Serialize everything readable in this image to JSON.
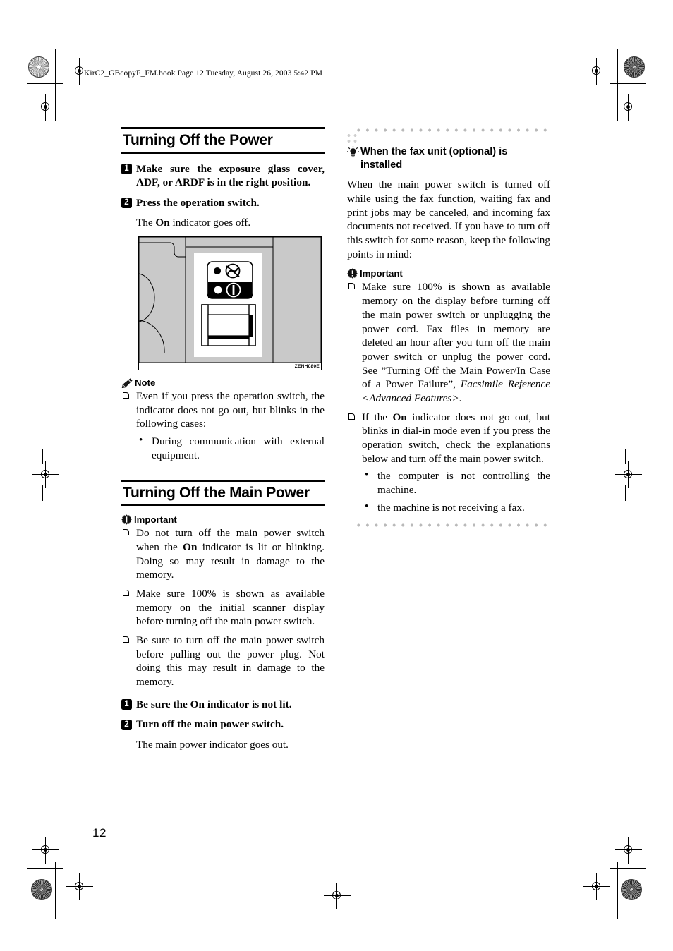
{
  "running_head": "KirC2_GBcopyF_FM.book  Page 12  Tuesday, August 26, 2003  5:42 PM",
  "page_number": "12",
  "left_column": {
    "section1": {
      "heading": "Turning Off the Power",
      "steps": [
        {
          "num": "1",
          "text": "Make sure the exposure glass cover, ADF, or ARDF is in the right position."
        },
        {
          "num": "2",
          "text": "Press the operation switch."
        }
      ],
      "step2_body_prefix": "The ",
      "step2_body_bold": "On",
      "step2_body_suffix": " indicator goes off.",
      "figure": {
        "code": "ZENH080E",
        "alt_name": "operation-switch-illustration"
      },
      "note": {
        "label": "Note",
        "icon": "pencil-icon",
        "items": [
          "Even if you press the operation switch, the indicator does not go out, but blinks in the following cases:"
        ],
        "subitems": [
          "During communication with external equipment."
        ]
      }
    },
    "section2": {
      "heading": "Turning Off the Main Power",
      "important": {
        "label": "Important",
        "icon": "important-icon",
        "item1_prefix": "Do not turn off the main power switch when the ",
        "item1_bold": "On",
        "item1_suffix": " indicator is lit or blinking. Doing so may result in damage to the memory.",
        "item2": "Make sure 100% is shown as available memory on the initial scanner display before turning off the main power switch.",
        "item3": "Be sure to turn off the main power switch before pulling out the power plug. Not doing this may result in damage to the memory."
      },
      "steps": [
        {
          "num": "1",
          "text": "Be sure the On indicator is not lit."
        },
        {
          "num": "2",
          "text": "Turn off the main power switch."
        }
      ],
      "step2_body": "The main power indicator goes out."
    }
  },
  "right_column": {
    "tip": {
      "icon": "lightbulb-icon",
      "heading": "When the fax unit (optional) is installed",
      "paragraph": "When the main power switch is turned off while using the fax function, waiting fax and print jobs may be canceled, and incoming fax documents not received. If you have to turn off this switch for some reason, keep the following points in mind:",
      "important": {
        "label": "Important",
        "icon": "important-icon",
        "item1_part1": "Make sure 100% is shown as available memory on the display before turning off the main power switch or unplugging the power cord. Fax files in memory are deleted an hour after you turn off the main power switch or unplug the power cord. See ”Turning Off the Main Power/In Case of a Power Failure”, ",
        "item1_italic": "Facsimile Reference <Advanced Features>",
        "item1_part2": ".",
        "item2_prefix": "If the ",
        "item2_bold": "On",
        "item2_suffix": " indicator does not go out, but blinks in dial-in mode even if you press the operation switch, check the explanations below and turn off the main power switch.",
        "subitems": [
          "the computer is not controlling the machine.",
          "the machine is not receiving a fax."
        ]
      }
    }
  }
}
